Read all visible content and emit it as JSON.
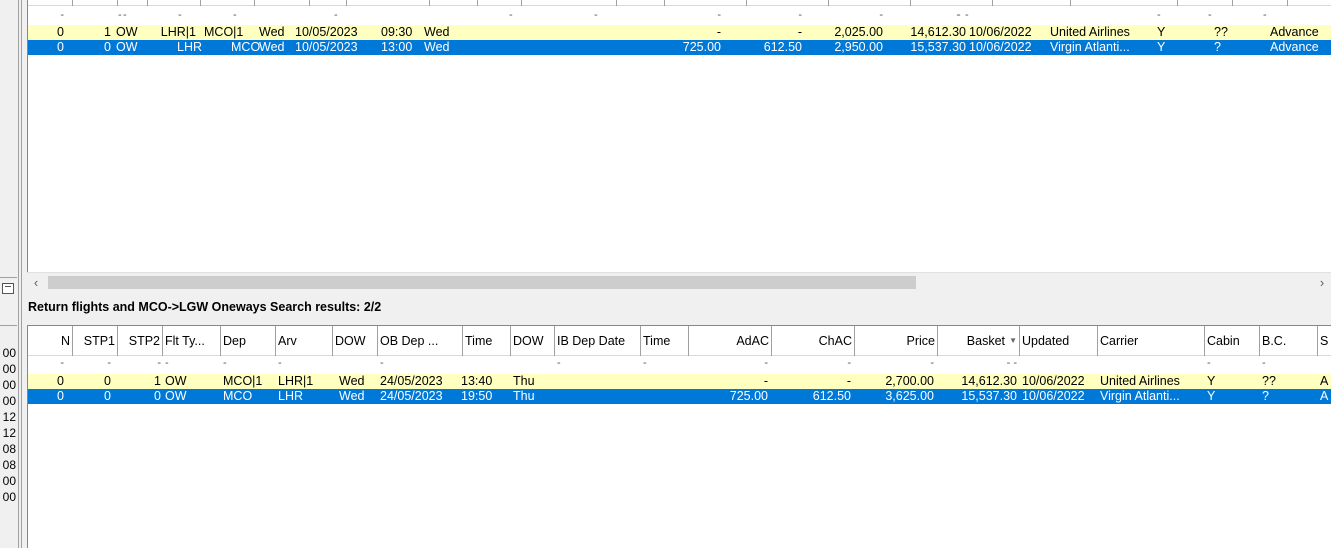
{
  "left_strip": {
    "values": [
      "00",
      "00",
      "00",
      "00",
      "12",
      "12",
      "08",
      "08",
      "00",
      "00"
    ]
  },
  "outbound_grid": {
    "filter_row": [
      "-",
      "-",
      "-",
      "-",
      "-",
      "-",
      "-",
      "-",
      "-",
      "-",
      "-",
      "-",
      "-",
      "-",
      "-",
      "-",
      "-",
      "-"
    ],
    "rows": [
      {
        "n": "0",
        "stp1": "",
        "stp2": "1",
        "type": "OW",
        "dep": "LHR|1",
        "arv": "MCO|1",
        "dow": "Wed",
        "ob_dep": "10/05/2023",
        "time": "09:30",
        "dow2": "Wed",
        "ib_dep": "",
        "time2": "",
        "adac": "-",
        "chac": "-",
        "price": "2,025.00",
        "basket": "14,612.30",
        "updated": "10/06/2022",
        "carrier": "United Airlines",
        "cabin": "Y",
        "bc": "??",
        "type2": "Advance"
      },
      {
        "n": "0",
        "stp1": "",
        "stp2": "0",
        "type": "OW",
        "dep": "LHR",
        "arv": "MCO",
        "dow": "Wed",
        "ob_dep": "10/05/2023",
        "time": "13:00",
        "dow2": "Wed",
        "ib_dep": "",
        "time2": "",
        "adac": "725.00",
        "chac": "612.50",
        "price": "2,950.00",
        "basket": "15,537.30",
        "updated": "10/06/2022",
        "carrier": "Virgin Atlanti...",
        "cabin": "Y",
        "bc": "?",
        "type2": "Advance"
      }
    ]
  },
  "results_label": "Return flights and MCO->LGW Oneways Search results: 2/2",
  "return_grid": {
    "headers": {
      "n": "N",
      "stp1": "STP1",
      "stp2": "STP2",
      "type": "Flt Ty...",
      "dep": "Dep",
      "arv": "Arv",
      "dow": "DOW",
      "ob_dep": "OB Dep ...",
      "time": "Time",
      "dow2": "DOW",
      "ib_dep": "IB Dep Date",
      "time2": "Time",
      "adac": "AdAC",
      "chac": "ChAC",
      "price": "Price",
      "basket": "Basket",
      "updated": "Updated",
      "carrier": "Carrier",
      "cabin": "Cabin",
      "bc": "B.C.",
      "s": "S"
    },
    "rows": [
      {
        "n": "0",
        "stp1": "0",
        "stp2": "1",
        "type": "OW",
        "dep": "MCO|1",
        "arv": "LHR|1",
        "dow": "Wed",
        "ob_dep": "24/05/2023",
        "time": "13:40",
        "dow2": "Thu",
        "ib_dep": "",
        "time2": "",
        "adac": "-",
        "chac": "-",
        "price": "2,700.00",
        "basket": "14,612.30",
        "updated": "10/06/2022",
        "carrier": "United Airlines",
        "cabin": "Y",
        "bc": "??",
        "s": "A"
      },
      {
        "n": "0",
        "stp1": "0",
        "stp2": "0",
        "type": "OW",
        "dep": "MCO",
        "arv": "LHR",
        "dow": "Wed",
        "ob_dep": "24/05/2023",
        "time": "19:50",
        "dow2": "Thu",
        "ib_dep": "",
        "time2": "",
        "adac": "725.00",
        "chac": "612.50",
        "price": "3,625.00",
        "basket": "15,537.30",
        "updated": "10/06/2022",
        "carrier": "Virgin Atlanti...",
        "cabin": "Y",
        "bc": "?",
        "s": "A"
      }
    ]
  },
  "colors": {
    "selected_row": "#0078d7",
    "highlight_row": "#ffffc0"
  },
  "icons": {
    "scroll_left": "chevron-left-icon",
    "scroll_right": "chevron-right-icon",
    "sort": "sort-down-icon"
  }
}
